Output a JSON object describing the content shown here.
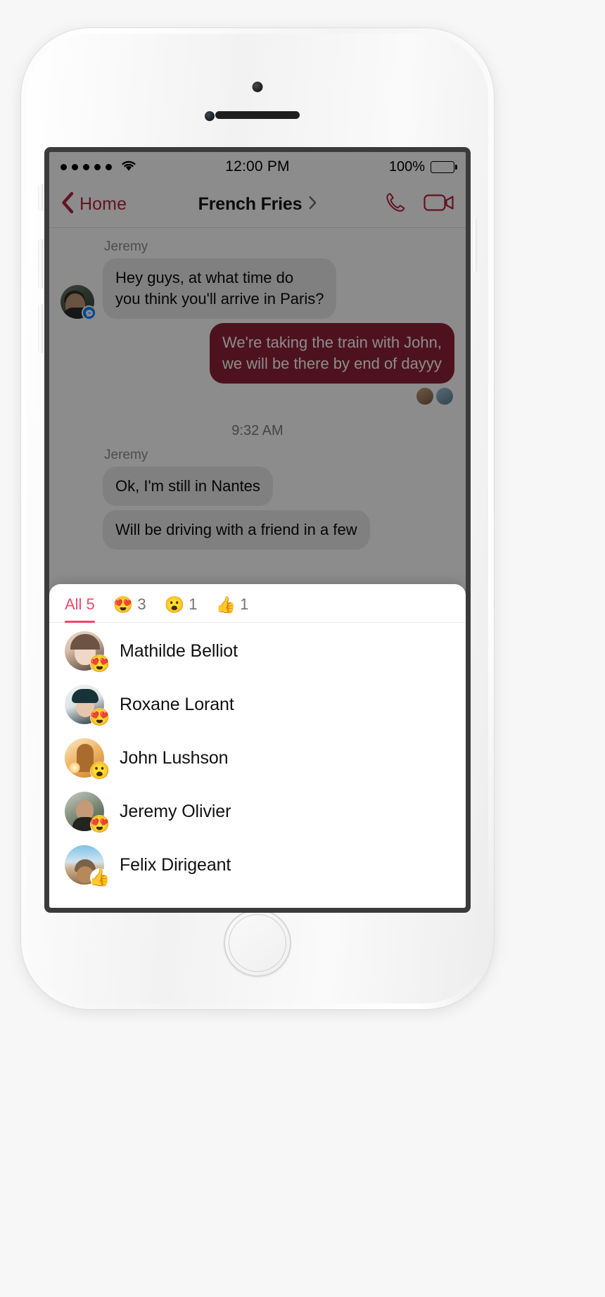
{
  "status_bar": {
    "signal_dots": 5,
    "wifi_icon": "wifi-icon",
    "time": "12:00 PM",
    "battery_percent": "100%",
    "battery_icon": "battery-full-icon"
  },
  "nav_bar": {
    "back_icon": "chevron-left-icon",
    "back_label": "Home",
    "title": "French Fries",
    "title_chevron_icon": "chevron-right-icon",
    "call_icon": "phone-icon",
    "video_icon": "video-camera-icon"
  },
  "conversation": {
    "sender_name_1": "Jeremy",
    "message_1": "Hey guys, at what time do\nyou think you'll arrive in Paris?",
    "message_1_line_1": "Hey guys, at what time do",
    "message_1_line_2": "you think you'll arrive in Paris?",
    "message_2": "We're taking the train with John,\nwe will be there by end of dayyy",
    "message_2_line_1": "We're taking the train with John,",
    "message_2_line_2": "we will be there by end of dayyy",
    "time_divider": "9:32 AM",
    "sender_name_2": "Jeremy",
    "message_3": "Ok, I'm still in Nantes",
    "message_4": "Will be driving with a friend in a few"
  },
  "reactions_sheet": {
    "tabs": [
      {
        "label": "All",
        "count": "5",
        "emoji": "",
        "active": true
      },
      {
        "label": "",
        "count": "3",
        "emoji": "😍",
        "active": false
      },
      {
        "label": "",
        "count": "1",
        "emoji": "😮",
        "active": false
      },
      {
        "label": "",
        "count": "1",
        "emoji": "👍",
        "active": false
      }
    ],
    "reactors": [
      {
        "name": "Mathilde Belliot",
        "emoji": "😍",
        "avatar_class": "av-mathilde"
      },
      {
        "name": "Roxane Lorant",
        "emoji": "😍",
        "avatar_class": "av-roxane"
      },
      {
        "name": "John Lushson",
        "emoji": "😮",
        "avatar_class": "av-john"
      },
      {
        "name": "Jeremy Olivier",
        "emoji": "😍",
        "avatar_class": "av-jeremy"
      },
      {
        "name": "Felix Dirigeant",
        "emoji": "👍",
        "avatar_class": "av-felix"
      }
    ]
  },
  "colors": {
    "accent_crimson": "#B32441",
    "bubble_outgoing": "#8E2239",
    "bubble_incoming": "#E9E9EB",
    "tab_active": "#EC4A6A",
    "messenger_blue": "#0084FF",
    "page_background": "#F7F7F8"
  }
}
